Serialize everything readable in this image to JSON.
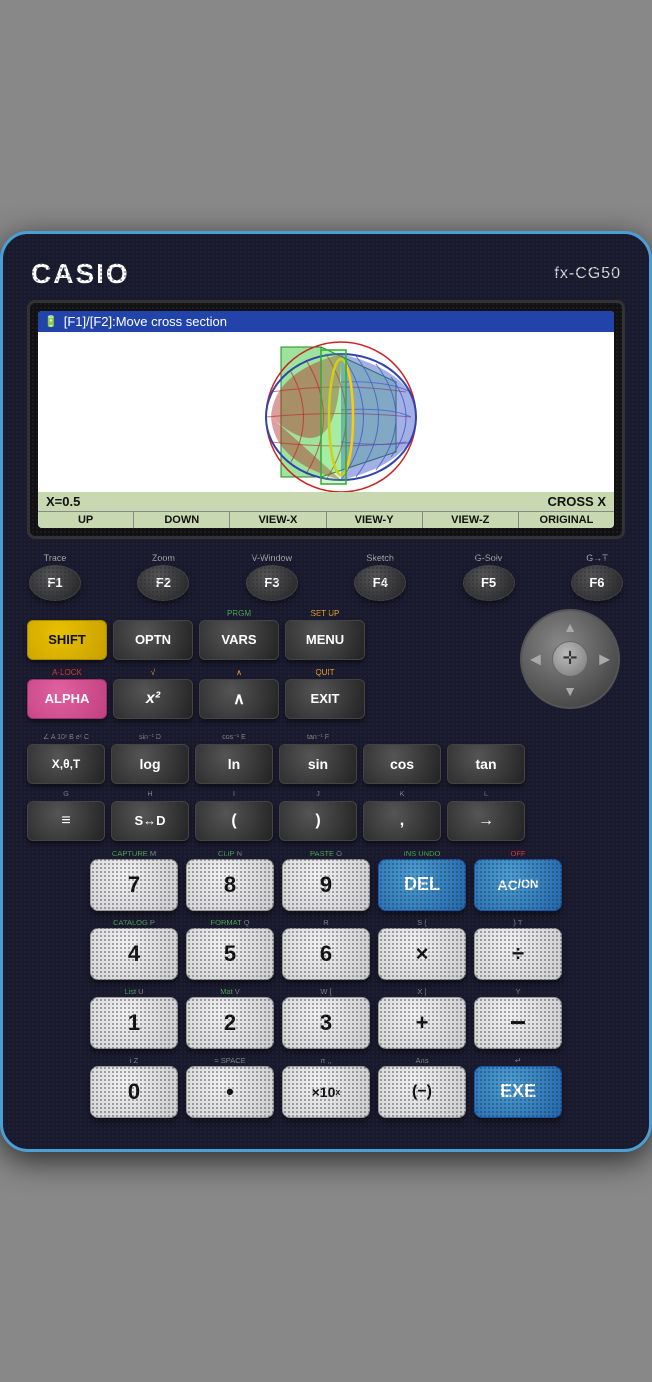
{
  "calculator": {
    "brand": "CASIO",
    "model": "fx-CG50"
  },
  "screen": {
    "top_text": "[F1]/[F2]:Move cross section",
    "x_value": "X=0.5",
    "cross_label": "CROSS X",
    "fn_buttons": [
      "UP",
      "DOWN",
      "VIEW-X",
      "VIEW-Y",
      "VIEW-Z",
      "ORIGINAL"
    ]
  },
  "f_keys": [
    {
      "label": "Trace",
      "key": "F1"
    },
    {
      "label": "Zoom",
      "key": "F2"
    },
    {
      "label": "V-Window",
      "key": "F3"
    },
    {
      "label": "Sketch",
      "key": "F4"
    },
    {
      "label": "G-Solv",
      "key": "F5"
    },
    {
      "label": "G→T",
      "key": "F6"
    }
  ],
  "row1": [
    {
      "top": "",
      "main": "SHIFT",
      "style": "yellow"
    },
    {
      "top": "",
      "main": "OPTN",
      "style": "dark"
    },
    {
      "top": "PRGM",
      "main": "VARS",
      "style": "dark"
    },
    {
      "top": "SET UP",
      "main": "MENU",
      "style": "dark"
    }
  ],
  "row2": [
    {
      "top": "A·LOCK",
      "main": "ALPHA",
      "style": "pink"
    },
    {
      "top": "√",
      "main": "x²",
      "style": "dark",
      "italic": true
    },
    {
      "top": "∧",
      "main": "∧",
      "style": "dark"
    },
    {
      "top": "QUIT",
      "main": "EXIT",
      "style": "dark"
    }
  ],
  "row3": [
    {
      "top": "∠  A  10ˣ  B  eˣ  C",
      "main": "X,θ,T",
      "style": "dark"
    },
    {
      "top": "sin⁻¹  D",
      "main": "log",
      "style": "dark"
    },
    {
      "top": "cos⁻¹  E",
      "main": "ln",
      "style": "dark"
    },
    {
      "top": "tan⁻¹  F",
      "main": "sin",
      "style": "dark"
    },
    {
      "top": "",
      "main": "cos",
      "style": "dark"
    },
    {
      "top": "",
      "main": "tan",
      "style": "dark"
    }
  ],
  "row4": [
    {
      "top": "G",
      "main": "≡",
      "style": "dark"
    },
    {
      "top": "H",
      "main": "S↔D",
      "style": "dark"
    },
    {
      "top": "I",
      "main": "(",
      "style": "dark"
    },
    {
      "top": "J",
      "main": ")",
      "style": "dark"
    },
    {
      "top": "K",
      "main": ",",
      "style": "dark"
    },
    {
      "top": "L",
      "main": "→",
      "style": "dark"
    }
  ],
  "numpad_rows": [
    {
      "top_labels": [
        "CAPTURE M",
        "CLIP N",
        "PASTE O",
        "INS   UNDO",
        "OFF"
      ],
      "keys": [
        {
          "main": "7",
          "style": "white"
        },
        {
          "main": "8",
          "style": "white"
        },
        {
          "main": "9",
          "style": "white"
        },
        {
          "main": "DEL",
          "style": "blue"
        },
        {
          "main": "AC/ON",
          "style": "blue",
          "superscript": ""
        }
      ]
    },
    {
      "top_labels": [
        "CATALOG P",
        "FORMAT Q",
        "R",
        "S {",
        "} T"
      ],
      "keys": [
        {
          "main": "4",
          "style": "white"
        },
        {
          "main": "5",
          "style": "white"
        },
        {
          "main": "6",
          "style": "white"
        },
        {
          "main": "×",
          "style": "white"
        },
        {
          "main": "÷",
          "style": "white"
        }
      ]
    },
    {
      "top_labels": [
        "List U",
        "Mat V",
        "W [",
        "X ]",
        "Y"
      ],
      "keys": [
        {
          "main": "1",
          "style": "white"
        },
        {
          "main": "2",
          "style": "white"
        },
        {
          "main": "3",
          "style": "white"
        },
        {
          "main": "+",
          "style": "white"
        },
        {
          "main": "−",
          "style": "white"
        }
      ]
    },
    {
      "top_labels": [
        "i Z",
        "= SPACE",
        "π ,,",
        "Ans",
        "↵"
      ],
      "keys": [
        {
          "main": "0",
          "style": "white"
        },
        {
          "main": "•",
          "style": "white"
        },
        {
          "main": "×10ˣ",
          "style": "white"
        },
        {
          "main": "(−)",
          "style": "white"
        },
        {
          "main": "EXE",
          "style": "blue"
        }
      ]
    }
  ]
}
